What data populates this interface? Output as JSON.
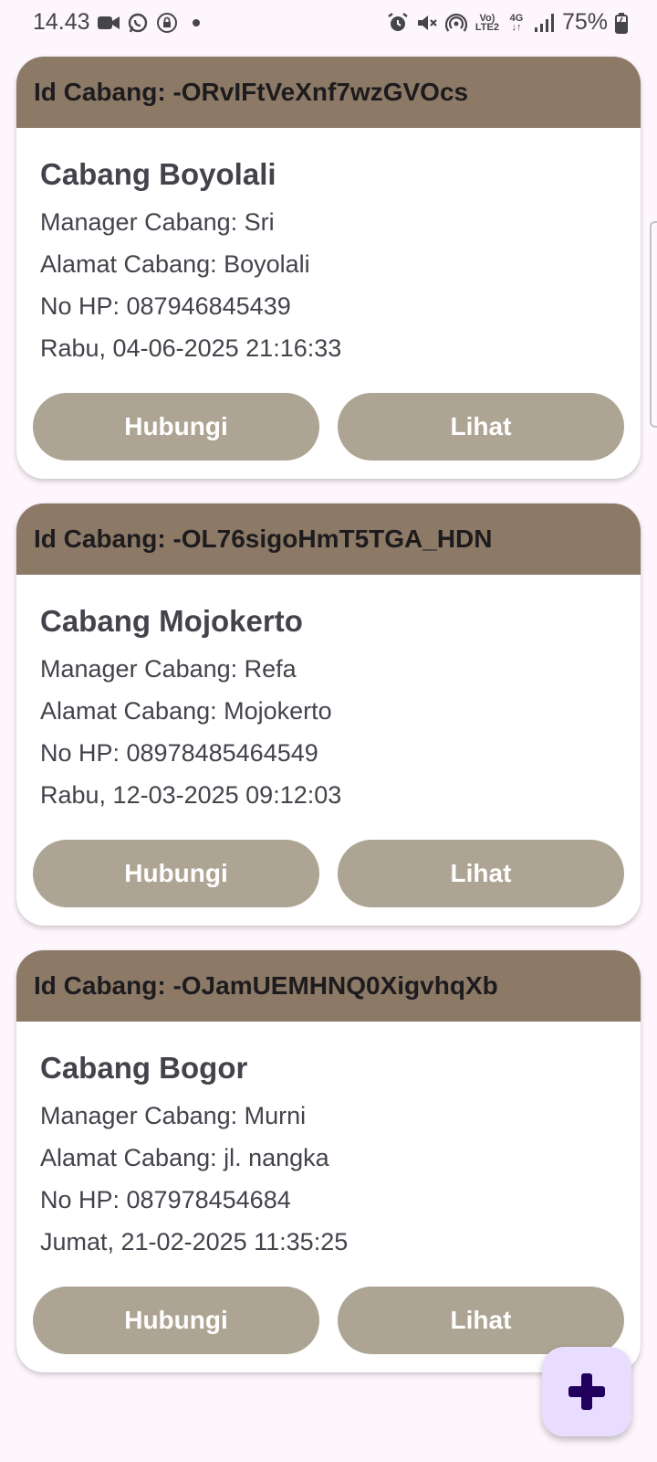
{
  "status_bar": {
    "time": "14.43",
    "network_top": "Vo)",
    "network_bottom": "LTE2",
    "signal_top": "4G",
    "battery": "75%"
  },
  "branches": [
    {
      "id_label": "Id Cabang: -ORvIFtVeXnf7wzGVOcs",
      "name": "Cabang Boyolali",
      "manager": "Manager Cabang: Sri",
      "address": "Alamat Cabang: Boyolali",
      "phone": "No HP: 087946845439",
      "datetime": "Rabu, 04-06-2025 21:16:33",
      "contact_label": "Hubungi",
      "view_label": "Lihat"
    },
    {
      "id_label": "Id Cabang: -OL76sigoHmT5TGA_HDN",
      "name": "Cabang Mojokerto",
      "manager": "Manager Cabang: Refa",
      "address": "Alamat Cabang: Mojokerto",
      "phone": "No HP: 08978485464549",
      "datetime": "Rabu, 12-03-2025 09:12:03",
      "contact_label": "Hubungi",
      "view_label": "Lihat"
    },
    {
      "id_label": "Id Cabang: -OJamUEMHNQ0XigvhqXb",
      "name": "Cabang Bogor",
      "manager": "Manager Cabang: Murni",
      "address": "Alamat Cabang: jl. nangka",
      "phone": "No HP: 087978454684",
      "datetime": "Jumat, 21-02-2025 11:35:25",
      "contact_label": "Hubungi",
      "view_label": "Lihat"
    }
  ],
  "fab": {
    "icon": "plus-icon"
  },
  "colors": {
    "header": "#8c7a67",
    "button": "#ada493",
    "fab": "#e9ddff",
    "fab_icon": "#21005d",
    "background": "#fdf7fd"
  }
}
